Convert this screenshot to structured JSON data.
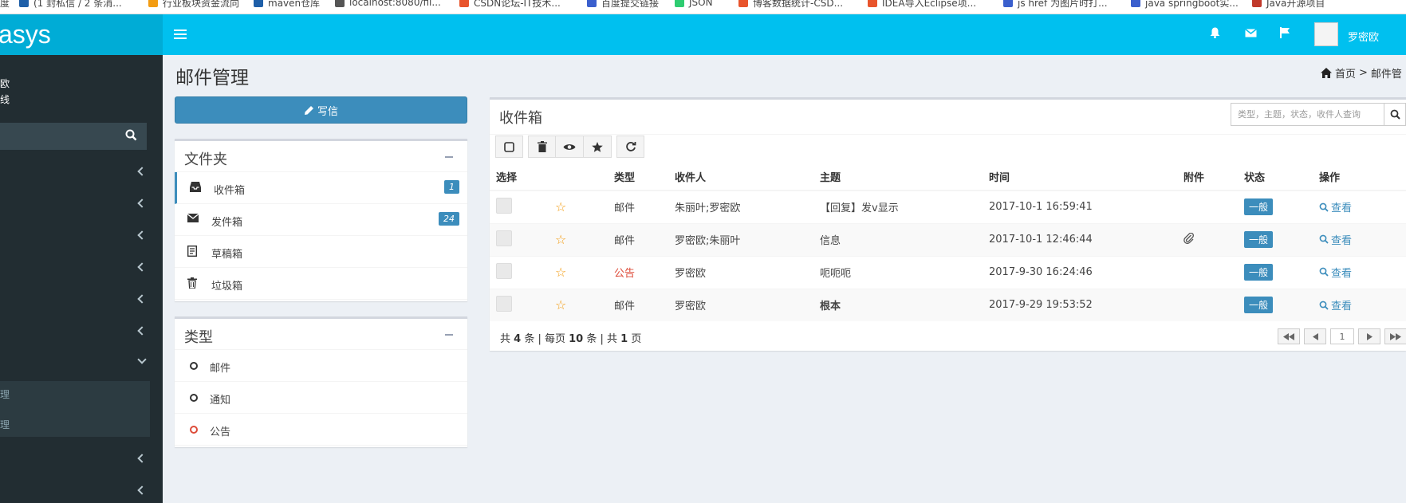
{
  "bookmarks": [
    {
      "label": "度",
      "color": "#e74c3c"
    },
    {
      "label": "(1 封私信 / 2 条消...",
      "color": "#1e5fa8"
    },
    {
      "label": "行业板块资金流向",
      "color": "#f39c12"
    },
    {
      "label": "maven仓库",
      "color": "#1e5fa8"
    },
    {
      "label": "localhost:8080/fil...",
      "color": "#555555"
    },
    {
      "label": "CSDN论坛-IT技术...",
      "color": "#e8542c"
    },
    {
      "label": "百度提交链接",
      "color": "#3a5fcd"
    },
    {
      "label": "JSON",
      "color": "#2ecc71"
    },
    {
      "label": "博客数据统计-CSD...",
      "color": "#e8542c"
    },
    {
      "label": "IDEA导入Eclipse项...",
      "color": "#e8542c"
    },
    {
      "label": "js href 为图片时打...",
      "color": "#3a5fcd"
    },
    {
      "label": "java springboot实...",
      "color": "#3a5fcd"
    },
    {
      "label": "Java开源项目",
      "color": "#c0392b"
    }
  ],
  "header": {
    "logo": "asys",
    "user_name": "罗密欧",
    "icons": [
      "bell-icon",
      "envelope-icon",
      "flag-icon"
    ]
  },
  "sidebar": {
    "user_line1": "欧",
    "user_line2": "线",
    "sub_items": [
      "理",
      "理"
    ]
  },
  "page": {
    "title": "邮件管理",
    "breadcrumb_home": "首页",
    "breadcrumb_sep": ">",
    "breadcrumb_current": "邮件管"
  },
  "compose_label": "写信",
  "folders": {
    "title": "文件夹",
    "items": [
      {
        "label": "收件箱",
        "badge": "1",
        "icon": "inbox-icon"
      },
      {
        "label": "发件箱",
        "badge": "24",
        "icon": "envelope-icon"
      },
      {
        "label": "草稿箱",
        "badge": "",
        "icon": "draft-icon"
      },
      {
        "label": "垃圾箱",
        "badge": "",
        "icon": "trash-icon"
      }
    ]
  },
  "types": {
    "title": "类型",
    "items": [
      {
        "label": "邮件",
        "color": "#333333"
      },
      {
        "label": "通知",
        "color": "#333333"
      },
      {
        "label": "公告",
        "color": "#dd4b39"
      }
    ]
  },
  "inbox": {
    "title": "收件箱",
    "search_placeholder": "类型，主题，状态，收件人查询",
    "columns": [
      "选择",
      "",
      "类型",
      "收件人",
      "主题",
      "时间",
      "附件",
      "状态",
      "操作"
    ],
    "rows": [
      {
        "type": "邮件",
        "type_red": false,
        "recipients": "朱丽叶;罗密欧",
        "subject": "【回复】发v显示",
        "subject_bold": false,
        "time": "2017-10-1 16:59:41",
        "attachment": false,
        "status": "一般",
        "action": "查看"
      },
      {
        "type": "邮件",
        "type_red": false,
        "recipients": "罗密欧;朱丽叶",
        "subject": "信息",
        "subject_bold": false,
        "time": "2017-10-1 12:46:44",
        "attachment": true,
        "status": "一般",
        "action": "查看"
      },
      {
        "type": "公告",
        "type_red": true,
        "recipients": "罗密欧",
        "subject": "呃呃呃",
        "subject_bold": false,
        "time": "2017-9-30 16:24:46",
        "attachment": false,
        "status": "一般",
        "action": "查看"
      },
      {
        "type": "邮件",
        "type_red": false,
        "recipients": "罗密欧",
        "subject": "根本",
        "subject_bold": true,
        "time": "2017-9-29 19:53:52",
        "attachment": false,
        "status": "一般",
        "action": "查看"
      }
    ],
    "footer": {
      "p1": "共",
      "total": "4",
      "p2": "条 | 每页",
      "per_page": "10",
      "p3": "条 | 共",
      "pages": "1",
      "p4": "页"
    },
    "current_page": "1"
  }
}
